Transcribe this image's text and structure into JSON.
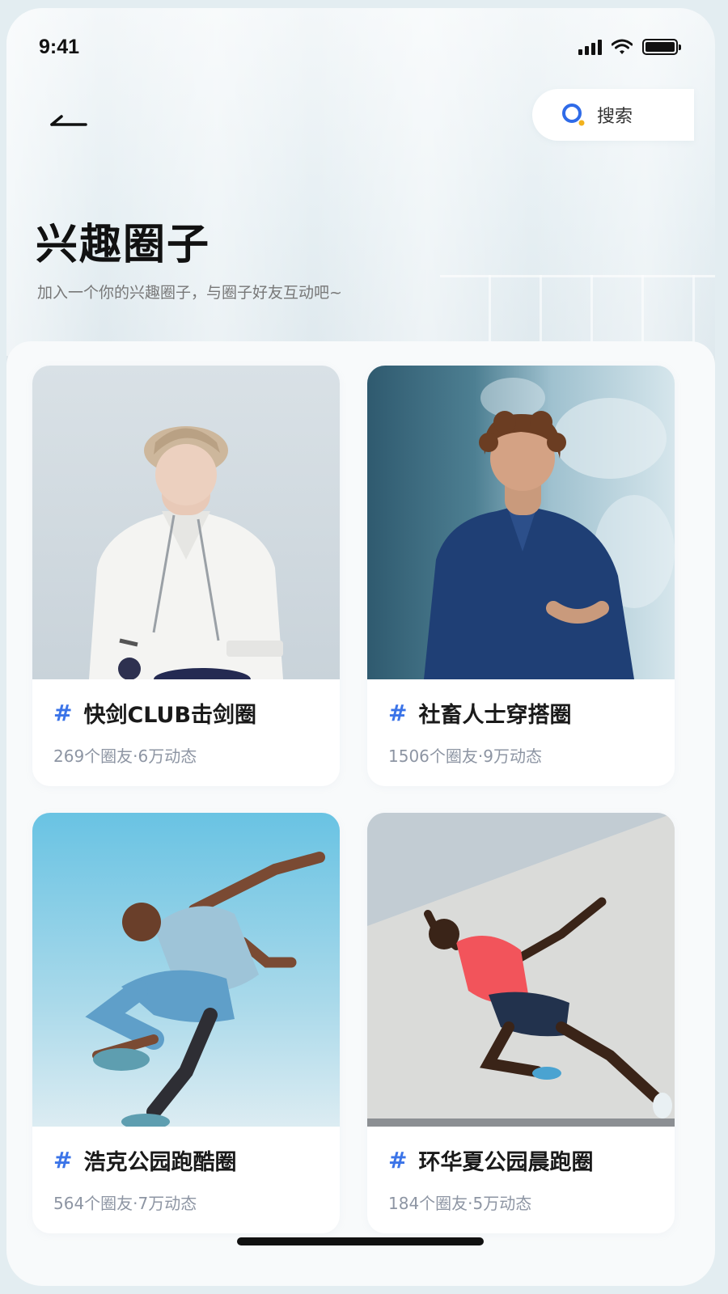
{
  "status_bar": {
    "time": "9:41"
  },
  "header": {
    "search_label": "搜索",
    "title": "兴趣圈子",
    "subtitle": "加入一个你的兴趣圈子，与圈子好友互动吧~"
  },
  "icons": {
    "back": "back-arrow-icon",
    "search": "search-icon",
    "signal": "cellular-signal-icon",
    "wifi": "wifi-icon",
    "battery": "battery-icon"
  },
  "colors": {
    "accent": "#3b74e8",
    "title": "#111111",
    "meta": "#8d95a3"
  },
  "circles": [
    {
      "hash": "#",
      "name": "快剑CLUB击剑圈",
      "meta": "269个圈友·6万动态"
    },
    {
      "hash": "#",
      "name": "社畜人士穿搭圈",
      "meta": "1506个圈友·9万动态"
    },
    {
      "hash": "#",
      "name": "浩克公园跑酷圈",
      "meta": "564个圈友·7万动态"
    },
    {
      "hash": "#",
      "name": "环华夏公园晨跑圈",
      "meta": "184个圈友·5万动态"
    }
  ]
}
